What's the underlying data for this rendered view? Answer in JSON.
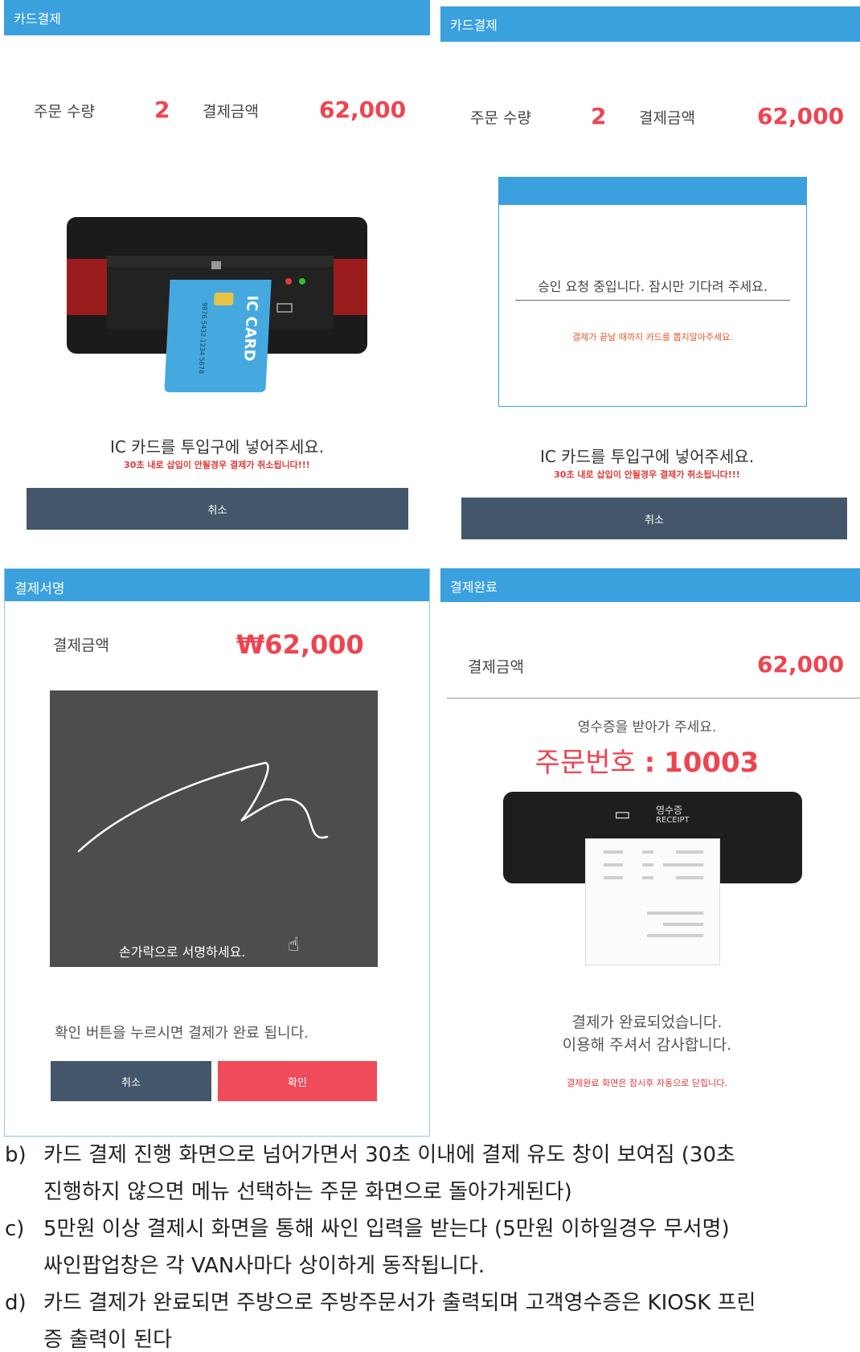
{
  "p1": {
    "title": "카드결제",
    "qty_label": "주문 수량",
    "qty": "2",
    "amount_label": "결제금액",
    "amount": "62,000",
    "card_text": "IC CARD",
    "card_number": "9876 5432 1234 5678",
    "instruction": "IC 카드를 투입구에 넣어주세요.",
    "warning": "30초 내로 삽입이 안될경우 결제가 취소됩니다!!!",
    "cancel": "취소"
  },
  "p2": {
    "title": "카드결제",
    "qty_label": "주문 수량",
    "qty": "2",
    "amount_label": "결제금액",
    "amount": "62,000",
    "modal_msg": "승인 요청 중입니다. 잠시만 기다려 주세요.",
    "modal_warning": "결제가 끝날 때까지 카드를 뽑지말아주세요.",
    "instruction": "IC 카드를 투입구에 넣어주세요.",
    "warning": "30초 내로 삽입이 안될경우 결제가 취소됩니다!!!",
    "cancel": "취소"
  },
  "p3": {
    "title": "결제서명",
    "amount_label": "결제금액",
    "amount": "₩62,000",
    "sign_hint": "손가락으로 서명하세요.",
    "confirm_msg": "확인 버튼을 누르시면 결제가 완료 됩니다.",
    "cancel": "취소",
    "ok": "확인"
  },
  "p4": {
    "title": "결제완료",
    "amount_label": "결제금액",
    "amount": "62,000",
    "receipt_msg": "영수증을 받아가 주세요.",
    "order_label": "주문번호",
    "order_sep": ":",
    "order_no": "10003",
    "receipt_ko": "영수증",
    "receipt_en": "RECEIPT",
    "done1": "결제가 완료되었습니다.",
    "done2": "이용해 주셔서 감사합니다.",
    "close_note": "결제완료 화면은 잠시후 자동으로 닫힙니다."
  },
  "captions": [
    {
      "marker": "b)",
      "lines": [
        "카드 결제 진행 화면으로 넘어가면서 30초 이내에 결제 유도 창이 보여짐 (30초",
        "진행하지 않으면 메뉴 선택하는 주문 화면으로 돌아가게된다)"
      ]
    },
    {
      "marker": "c)",
      "lines": [
        "5만원 이상 결제시 화면을 통해 싸인 입력을 받는다 (5만원 이하일경우 무서명)",
        "싸인팝업창은 각 VAN사마다 상이하게 동작됩니다."
      ]
    },
    {
      "marker": "d)",
      "lines": [
        "카드 결제가 완료되면 주방으로 주방주문서가 출력되며 고객영수증은 KIOSK 프린",
        "증 출력이 된다"
      ]
    }
  ],
  "colors": {
    "header": "#3aa0de",
    "accent": "#ee4450",
    "button": "#44576a",
    "confirm": "#ef4b5b"
  }
}
